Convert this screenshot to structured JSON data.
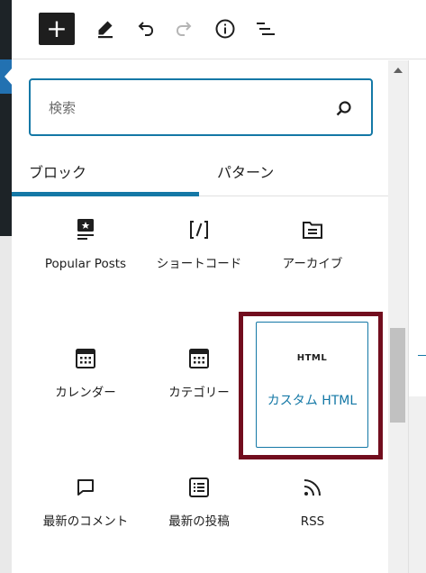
{
  "toolbar": {
    "add_label": "+",
    "buttons": [
      "add-block",
      "edit",
      "undo",
      "redo",
      "details",
      "list-view"
    ]
  },
  "inserter": {
    "search": {
      "placeholder": "検索"
    },
    "tabs": [
      {
        "label": "ブロック",
        "active": true
      },
      {
        "label": "パターン",
        "active": false
      }
    ],
    "blocks": [
      {
        "label": "Popular Posts",
        "icon": "popular-posts-icon"
      },
      {
        "label": "ショートコード",
        "icon": "shortcode-icon"
      },
      {
        "label": "アーカイブ",
        "icon": "archive-icon"
      },
      {
        "label": "カレンダー",
        "icon": "calendar-icon"
      },
      {
        "label": "カテゴリー",
        "icon": "category-icon"
      },
      {
        "label": "カスタム HTML",
        "icon_text": "HTML",
        "selected": true
      },
      {
        "label": "最新のコメント",
        "icon": "comment-icon"
      },
      {
        "label": "最新の投稿",
        "icon": "list-icon"
      },
      {
        "label": "RSS",
        "icon": "rss-icon"
      }
    ]
  },
  "colors": {
    "accent": "#1478a6",
    "highlight": "#720d1e",
    "admin_bar": "#1d2327"
  }
}
